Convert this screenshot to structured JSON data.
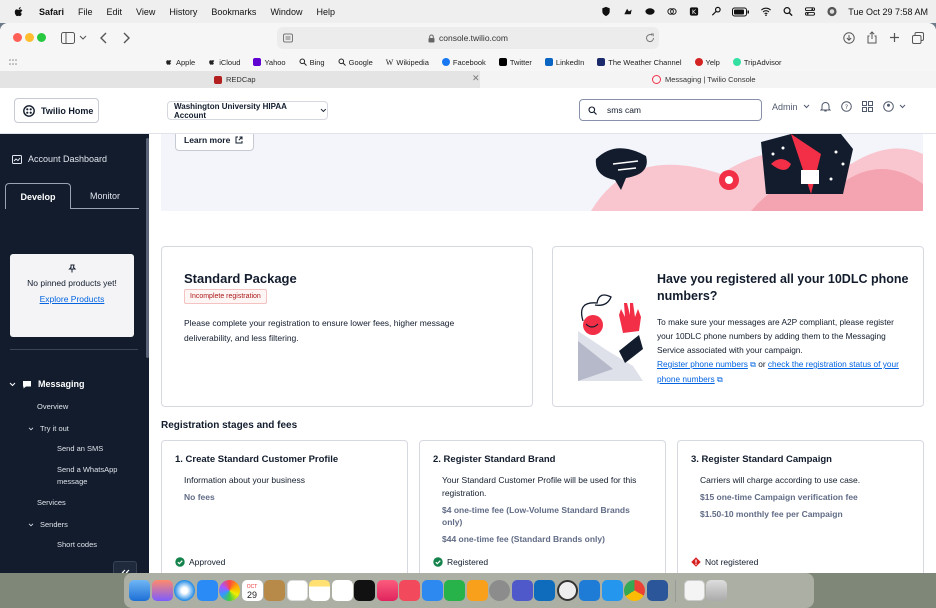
{
  "menubar": {
    "app": "Safari",
    "menus": [
      "File",
      "Edit",
      "View",
      "History",
      "Bookmarks",
      "Window",
      "Help"
    ],
    "datetime": "Tue Oct 29  7:58 AM"
  },
  "browser": {
    "url": "console.twilio.com",
    "favorites": [
      "Apple",
      "iCloud",
      "Yahoo",
      "Bing",
      "Google",
      "Wikipedia",
      "Facebook",
      "Twitter",
      "LinkedIn",
      "The Weather Channel",
      "Yelp",
      "TripAdvisor"
    ],
    "tabs": [
      {
        "title": "REDCap",
        "active": false
      },
      {
        "title": "Messaging | Twilio Console",
        "active": true
      }
    ]
  },
  "header": {
    "home_label": "Twilio Home",
    "account_label": "Washington University HIPAA Account",
    "search_value": "sms cam",
    "admin_label": "Admin"
  },
  "sidebar": {
    "account_dashboard": "Account Dashboard",
    "tabs": [
      "Develop",
      "Monitor"
    ],
    "pinned_text": "No pinned products yet!",
    "explore_link": "Explore Products",
    "nav": {
      "messaging": "Messaging",
      "overview": "Overview",
      "try_it_out": "Try it out",
      "send_sms": "Send an SMS",
      "send_whatsapp": "Send a WhatsApp message",
      "services": "Services",
      "senders": "Senders",
      "short_codes": "Short codes"
    }
  },
  "main": {
    "learn_more": "Learn more",
    "package": {
      "title": "Standard Package",
      "badge": "Incomplete registration",
      "description": "Please complete your registration to ensure lower fees, higher message deliverability, and less filtering."
    },
    "register": {
      "title": "Have you registered all your 10DLC phone numbers?",
      "description": "To make sure your messages are A2P compliant, please register your 10DLC phone numbers by adding them to the Messaging Service associated with your campaign.",
      "link1": "Register phone numbers",
      "or": "or",
      "link2": "check the registration status of your phone numbers"
    },
    "stages_title": "Registration stages and fees",
    "stages": [
      {
        "title": "1. Create Standard Customer Profile",
        "desc": "Information about your business",
        "fees": [
          "No fees"
        ],
        "status": "Approved",
        "status_color": "#14824b"
      },
      {
        "title": "2. Register Standard Brand",
        "desc": "Your Standard Customer Profile will be used for this registration.",
        "fees": [
          "$4 one-time fee (Low-Volume Standard Brands only)",
          "$44 one-time fee (Standard Brands only)"
        ],
        "status": "Registered",
        "status_color": "#14824b"
      },
      {
        "title": "3. Register Standard Campaign",
        "desc": "Carriers will charge according to use case.",
        "fees": [
          "$15 one-time Campaign verification fee",
          "$1.50-10 monthly fee per Campaign"
        ],
        "status": "Not registered",
        "status_color": "#d61f1f"
      }
    ]
  },
  "dock": {
    "calendar_day": "29",
    "calendar_month": "OCT"
  },
  "colors": {
    "sidebar_bg": "#121c2d",
    "link": "#0263e0",
    "accent": "#f22f46"
  }
}
